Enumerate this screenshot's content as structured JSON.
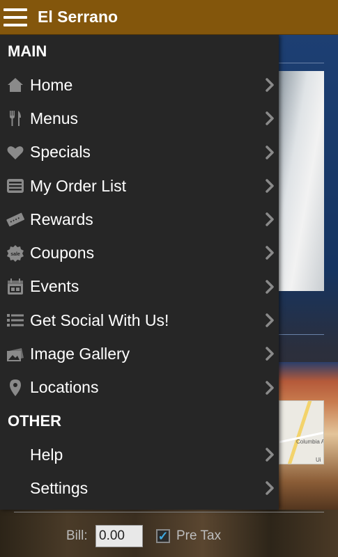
{
  "app": {
    "title": "El Serrano"
  },
  "drawer": {
    "main_header": "MAIN",
    "main_items": [
      {
        "label": "Home",
        "icon": "home-icon"
      },
      {
        "label": "Menus",
        "icon": "fork-knife-icon"
      },
      {
        "label": "Specials",
        "icon": "heart-icon"
      },
      {
        "label": "My Order List",
        "icon": "list-box-icon"
      },
      {
        "label": "Rewards",
        "icon": "ticket-icon"
      },
      {
        "label": "Coupons",
        "icon": "sale-tag-icon"
      },
      {
        "label": "Events",
        "icon": "calendar-icon"
      },
      {
        "label": "Get Social With Us!",
        "icon": "bulleted-list-icon"
      },
      {
        "label": "Image Gallery",
        "icon": "gallery-icon"
      },
      {
        "label": "Locations",
        "icon": "map-pin-icon"
      }
    ],
    "other_header": "OTHER",
    "other_items": [
      {
        "label": "Help"
      },
      {
        "label": "Settings"
      }
    ]
  },
  "background": {
    "bill_label": "Bill:",
    "bill_value": "0.00",
    "pretax_label": "Pre Tax",
    "pretax_checked": true,
    "map_label": "Columbia Av",
    "map_label2": "Ui"
  },
  "colors": {
    "topbar": "#83560c",
    "drawer": "#262626",
    "icon_gray": "#8a8a8a",
    "checkbox_accent": "#3ea8e0"
  }
}
